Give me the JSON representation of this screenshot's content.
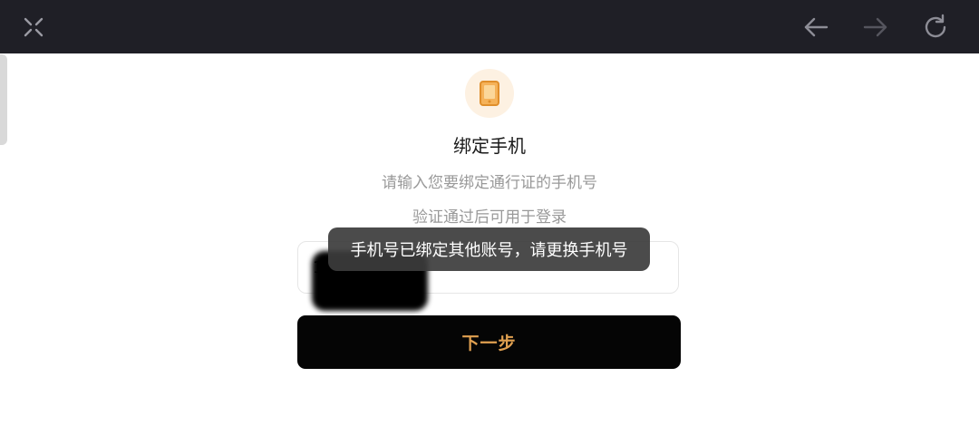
{
  "toolbar": {
    "close_icon": "close-x-icon",
    "back_icon": "arrow-left-icon",
    "forward_icon": "arrow-right-icon",
    "refresh_icon": "refresh-icon",
    "background_color": "#1f1f26"
  },
  "main": {
    "badge_icon": "phone-icon",
    "title": "绑定手机",
    "subtitle_line1": "请输入您要绑定通行证的手机号",
    "subtitle_line2": "验证通过后可用于登录",
    "phone_input": {
      "value": "1"
    },
    "next_button_label": "下一步",
    "accent_color": "#e0a050"
  },
  "toast": {
    "message": "手机号已绑定其他账号，请更换手机号"
  }
}
